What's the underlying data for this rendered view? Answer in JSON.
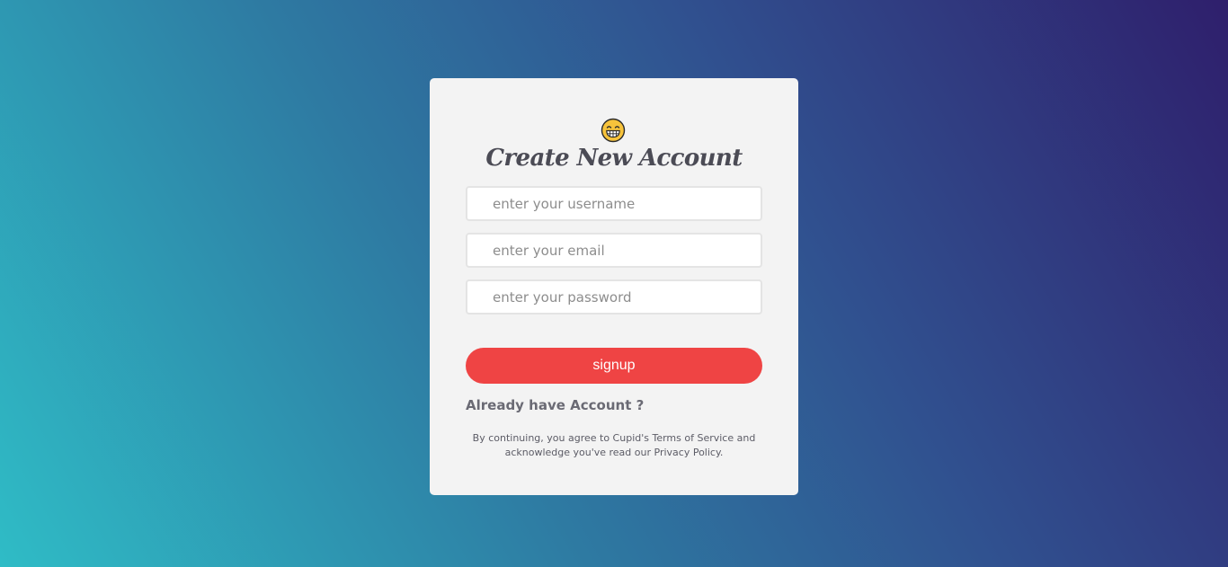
{
  "form": {
    "emoji_icon": "grinning-face-emoji",
    "title": "Create New Account",
    "username_placeholder": "enter your username",
    "email_placeholder": "enter your email",
    "password_placeholder": "enter your password",
    "signup_label": "signup",
    "already_label": "Already have Account ?",
    "legal_line1": "By continuing, you agree to Cupid's Terms of Service and",
    "legal_line2": "acknowledge you've read our Privacy Policy."
  },
  "colors": {
    "card_bg": "#f3f3f3",
    "signup_button": "#ef4444",
    "gradient_start": "#2fbcc6",
    "gradient_end": "#2f1f6c",
    "title_text": "#4b4b55"
  }
}
